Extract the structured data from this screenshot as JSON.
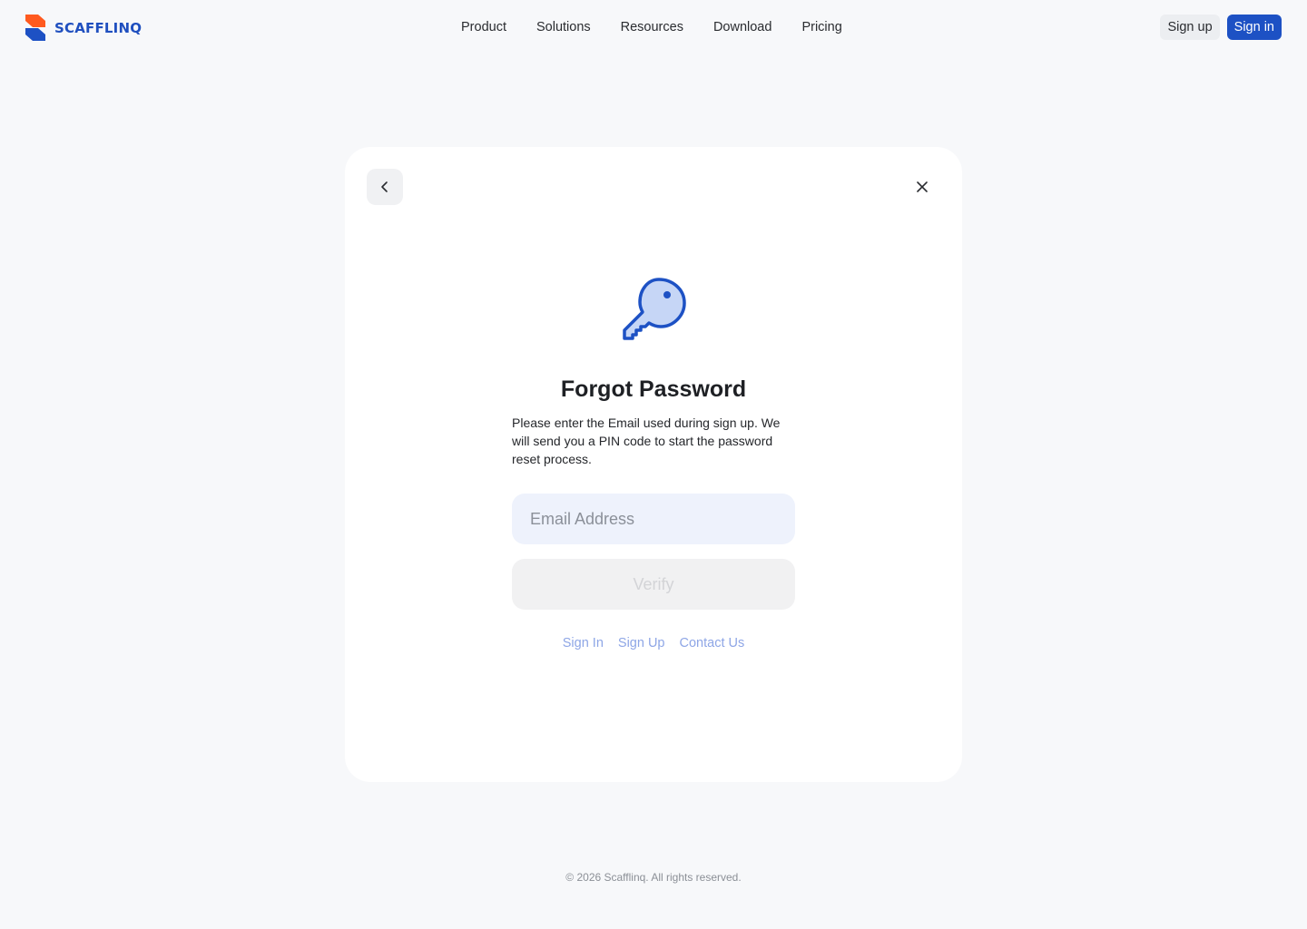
{
  "brand": {
    "name": "SCAFFLINQ",
    "colors": {
      "primary": "#1d51c4",
      "accent": "#ff5a1f",
      "background": "#f7f8fa"
    }
  },
  "nav": {
    "items": [
      {
        "label": "Product"
      },
      {
        "label": "Solutions"
      },
      {
        "label": "Resources"
      },
      {
        "label": "Download"
      },
      {
        "label": "Pricing"
      }
    ]
  },
  "auth": {
    "signup_label": "Sign up",
    "signin_label": "Sign in"
  },
  "modal": {
    "back_icon": "chevron-left-icon",
    "close_icon": "close-icon",
    "hero_icon": "key-icon",
    "title": "Forgot Password",
    "description": "Please enter the Email used during sign up. We will send you a PIN code to start the password reset process.",
    "email": {
      "placeholder": "Email Address",
      "value": ""
    },
    "verify_label": "Verify",
    "links": [
      {
        "label": "Sign In"
      },
      {
        "label": "Sign Up"
      },
      {
        "label": "Contact Us"
      }
    ]
  },
  "footer": {
    "copyright": "© 2026 Scafflinq. All rights reserved."
  }
}
